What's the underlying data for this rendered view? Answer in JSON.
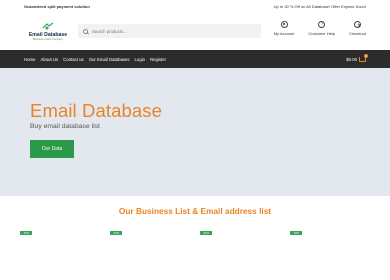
{
  "topbar": {
    "left": "Guaranteed split payment solution",
    "right": "Up to 30 % Off on All Database! Offer Expires Soon!"
  },
  "logo": {
    "title": "Email Database",
    "subtitle": "Business Leads Company",
    "icon": "megaphone-logo-icon",
    "color": "#1c2b45"
  },
  "search": {
    "placeholder": "Search products..."
  },
  "header_actions": [
    {
      "label": "My Account",
      "icon": "user-icon"
    },
    {
      "label": "Customer Help",
      "icon": "help-icon"
    },
    {
      "label": "Checkout",
      "icon": "checkout-icon"
    }
  ],
  "nav": {
    "items": [
      "Home",
      "About Us",
      "Contact us",
      "Our Email Databases",
      "Login",
      "Register"
    ],
    "cart_total": "$0.00",
    "cart_count": "0"
  },
  "hero": {
    "title": "Email Database",
    "subtitle": "Buy email database list",
    "button": "Our Data"
  },
  "section": {
    "title": "Our Business List & Email address list"
  },
  "badges": [
    "-67%",
    "-67%",
    "-67%",
    "-70%"
  ],
  "colors": {
    "accent": "#e8832a",
    "green": "#2b9a48",
    "nav_bg": "#2c2c2c",
    "hero_bg": "#e3e8ee"
  }
}
